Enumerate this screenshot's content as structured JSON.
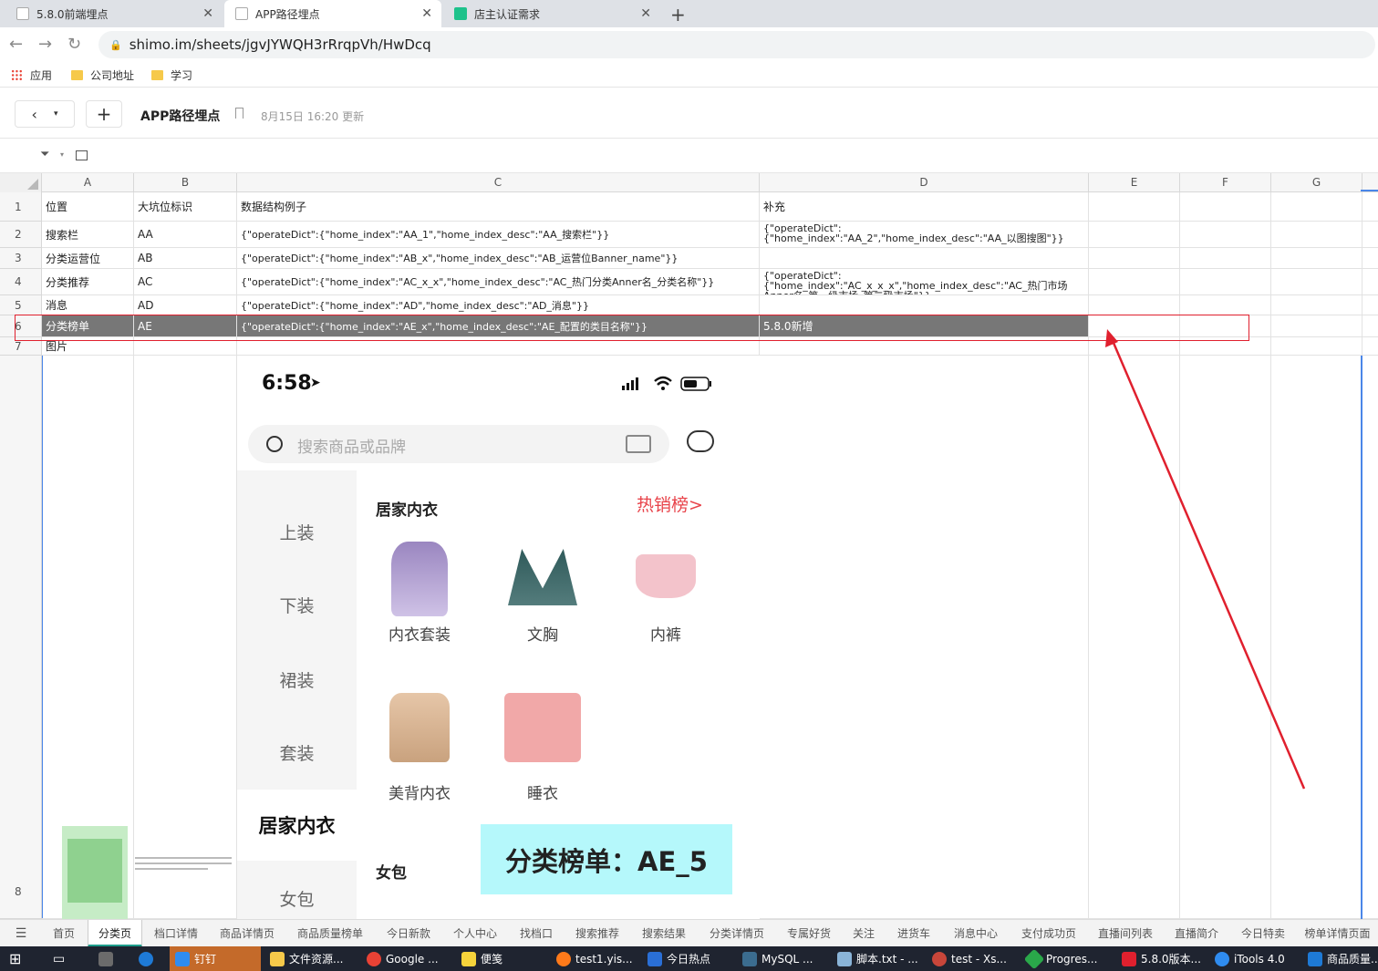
{
  "browser": {
    "tabs": [
      {
        "title": "5.8.0前端埋点",
        "active": false
      },
      {
        "title": "APP路径埋点",
        "active": true
      },
      {
        "title": "店主认证需求",
        "active": false
      }
    ],
    "url": "shimo.im/sheets/jgvJYWQH3rRrqpVh/HwDcq",
    "bookmarks": [
      "应用",
      "公司地址",
      "学习"
    ]
  },
  "doc": {
    "title": "APP路径埋点",
    "updated": "8月15日 16:20 更新"
  },
  "columns": [
    "A",
    "B",
    "C",
    "D",
    "E",
    "F",
    "G"
  ],
  "rows": [
    {
      "num": "1",
      "a": "位置",
      "b": "大坑位标识",
      "c": "数据结构例子",
      "d": "补充"
    },
    {
      "num": "2",
      "a": "搜索栏",
      "b": "AA",
      "c": "{\"operateDict\":{\"home_index\":\"AA_1\",\"home_index_desc\":\"AA_搜索栏\"}}",
      "d": "{\"operateDict\":{\"home_index\":\"AA_2\",\"home_index_desc\":\"AA_以图搜图\"}}"
    },
    {
      "num": "3",
      "a": "分类运营位",
      "b": "AB",
      "c": "{\"operateDict\":{\"home_index\":\"AB_x\",\"home_index_desc\":\"AB_运营位Banner_name\"}}",
      "d": ""
    },
    {
      "num": "4",
      "a": "分类推荐",
      "b": "AC",
      "c": "{\"operateDict\":{\"home_index\":\"AC_x_x\",\"home_index_desc\":\"AC_热门分类Anner名_分类名称\"}}",
      "d": "{\"operateDict\":{\"home_index\":\"AC_x_x_x\",\"home_index_desc\":\"AC_热门市场Anner名_第一级市场_第二级市场\"}}"
    },
    {
      "num": "5",
      "a": "消息",
      "b": "AD",
      "c": "{\"operateDict\":{\"home_index\":\"AD\",\"home_index_desc\":\"AD_消息\"}}",
      "d": ""
    },
    {
      "num": "6",
      "a": "分类榜单",
      "b": "AE",
      "c": "{\"operateDict\":{\"home_index\":\"AE_x\",\"home_index_desc\":\"AE_配置的类目名称\"}}",
      "d": "5.8.0新增"
    },
    {
      "num": "7",
      "a": "图片",
      "b": "",
      "c": "",
      "d": ""
    },
    {
      "num": "8",
      "a": "",
      "b": "",
      "c": "",
      "d": ""
    }
  ],
  "phone": {
    "time": "6:58",
    "search_placeholder": "搜索商品或品牌",
    "categories": [
      "上装",
      "下装",
      "裙装",
      "套装",
      "居家内衣",
      "女包"
    ],
    "section_title": "居家内衣",
    "hot_link": "热销榜>",
    "products": [
      "内衣套装",
      "文胸",
      "内裤",
      "美背内衣",
      "睡衣"
    ],
    "section2_title": "女包",
    "annotation": "分类榜单：AE_5"
  },
  "sheet_tabs": [
    "首页",
    "分类页",
    "档口详情",
    "商品详情页",
    "商品质量榜单",
    "今日新款",
    "个人中心",
    "找档口",
    "搜索推荐",
    "搜索结果",
    "分类详情页",
    "专属好货",
    "关注",
    "进货车",
    "消息中心",
    "支付成功页",
    "直播间列表",
    "直播简介",
    "今日特卖",
    "榜单详情页面"
  ],
  "active_sheet": "分类页",
  "taskbar": [
    "钉钉",
    "文件资源...",
    "Google ...",
    "便笺",
    "test1.yis...",
    "今日热点",
    "MySQL ...",
    "脚本.txt - ...",
    "test - Xs...",
    "Progres...",
    "5.8.0版本...",
    "iTools 4.0",
    "商品质量..."
  ],
  "colors": {
    "accent": "#1e9d8b",
    "highlight": "#e0202e",
    "selected_row": "#777777",
    "annotation_bg": "#b5f8fb"
  }
}
